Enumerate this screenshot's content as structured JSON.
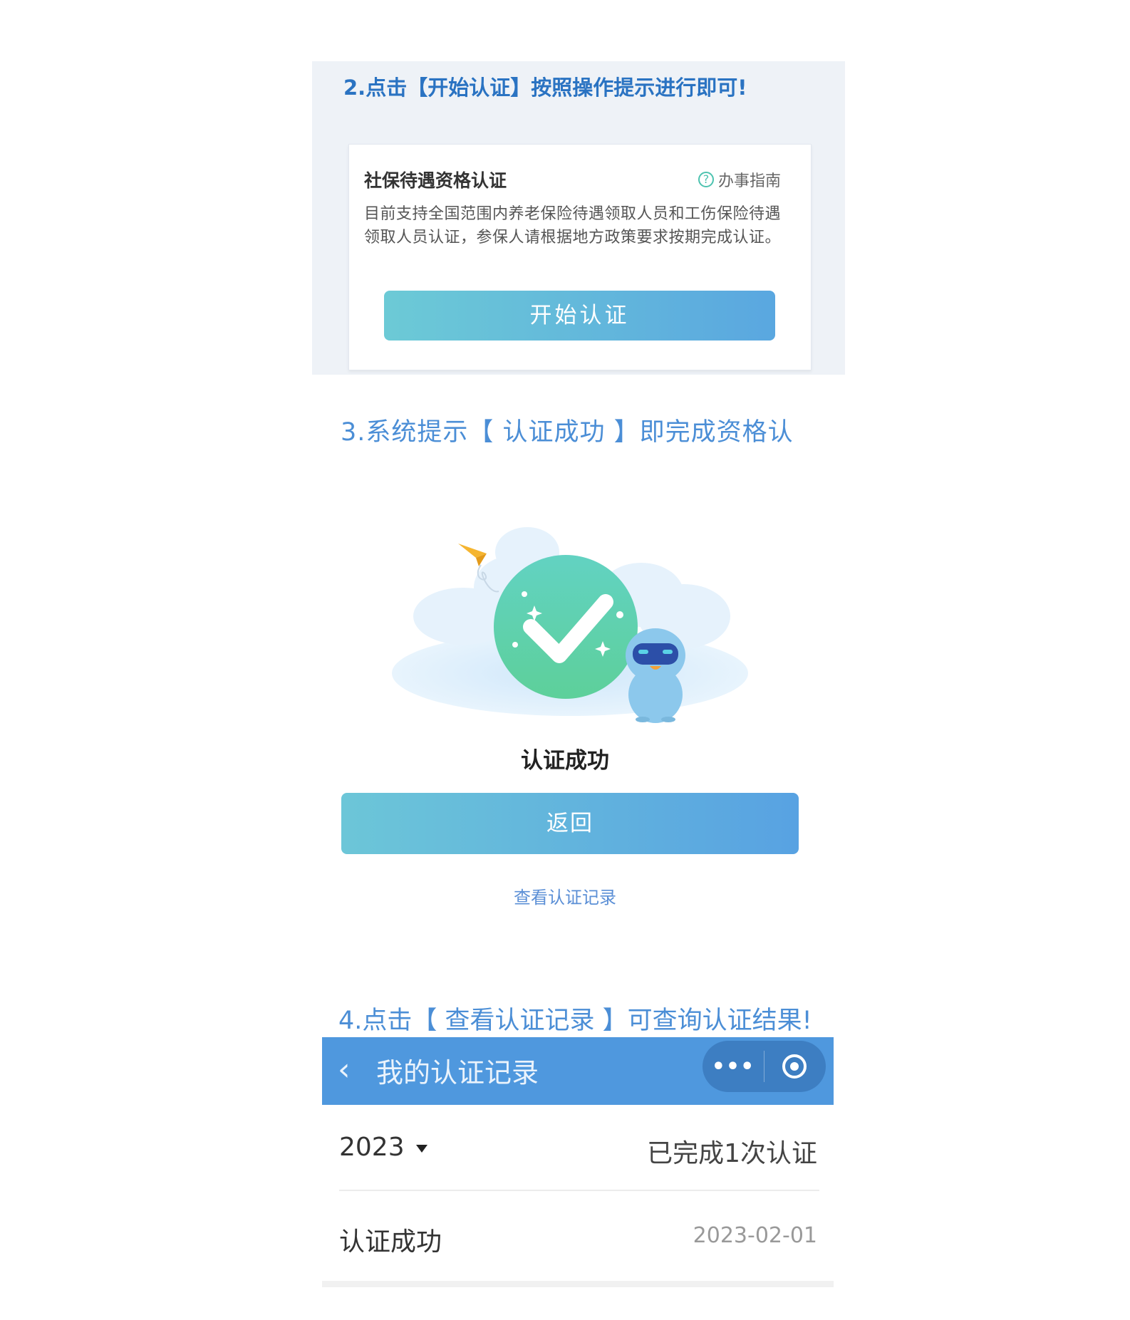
{
  "section2": {
    "heading": "2.点击【开始认证】按照操作提示进行即可!",
    "card": {
      "title": "社保待遇资格认证",
      "guide_icon": "question-circle-icon",
      "guide_label": "办事指南",
      "description": "目前支持全国范围内养老保险待遇领取人员和工伤保险待遇领取人员认证，参保人请根据地方政策要求按期完成认证。",
      "start_button": "开始认证"
    }
  },
  "section3": {
    "heading": "3.系统提示【 认证成功 】即完成资格认",
    "illustration_icon": "success-check-illustration",
    "result_title": "认证成功",
    "back_button": "返回",
    "record_link": "查看认证记录"
  },
  "section4": {
    "heading": "4.点击【 查看认证记录 】可查询认证结果!",
    "navbar": {
      "back_icon": "chevron-left-icon",
      "back_glyph": "‹",
      "title": "我的认证记录",
      "more_glyph": "•••",
      "more_icon": "more-dots-icon",
      "close_icon": "target-circle-icon"
    },
    "year": "2023",
    "year_dropdown_icon": "triangle-down-icon",
    "completed_count": "已完成1次认证",
    "records": [
      {
        "status": "认证成功",
        "date": "2023-02-01"
      }
    ]
  },
  "colors": {
    "heading_blue": "#4b8ed6",
    "heading_blue_dark": "#2a73c2",
    "navbar_blue": "#4f98de",
    "button_gradient_start": "#6ccad6",
    "button_gradient_end": "#5aa7e0",
    "success_green": "#56cfa3"
  }
}
